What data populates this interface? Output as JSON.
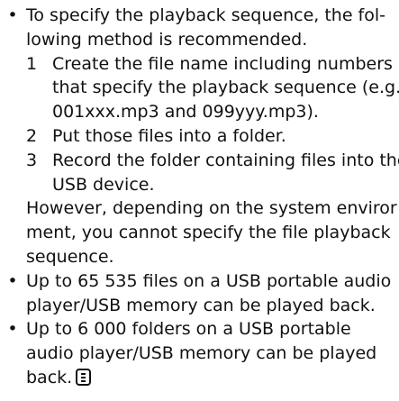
{
  "bullet_symbol": "•",
  "items": [
    {
      "lines": [
        "To specify the playback sequence, the fol-",
        "lowing method is recommended."
      ],
      "steps": [
        {
          "num": "1",
          "lines": [
            "Create the file name including numbers",
            "that specify the playback sequence (e.g.,",
            "001xxx.mp3 and 099yyy.mp3)."
          ]
        },
        {
          "num": "2",
          "lines": [
            "Put those files into a folder."
          ]
        },
        {
          "num": "3",
          "lines": [
            "Record the folder containing files into the",
            "USB device."
          ]
        }
      ],
      "after_lines": [
        "However, depending on the system enviror",
        "ment, you cannot specify the file playback",
        "sequence."
      ]
    },
    {
      "lines": [
        "Up to 65 535 files on a USB portable audio",
        "player/USB memory can be played back."
      ]
    },
    {
      "lines": [
        "Up to 6 000 folders on a USB portable",
        "audio player/USB memory can be played",
        "back."
      ],
      "icon": "note-icon"
    }
  ]
}
